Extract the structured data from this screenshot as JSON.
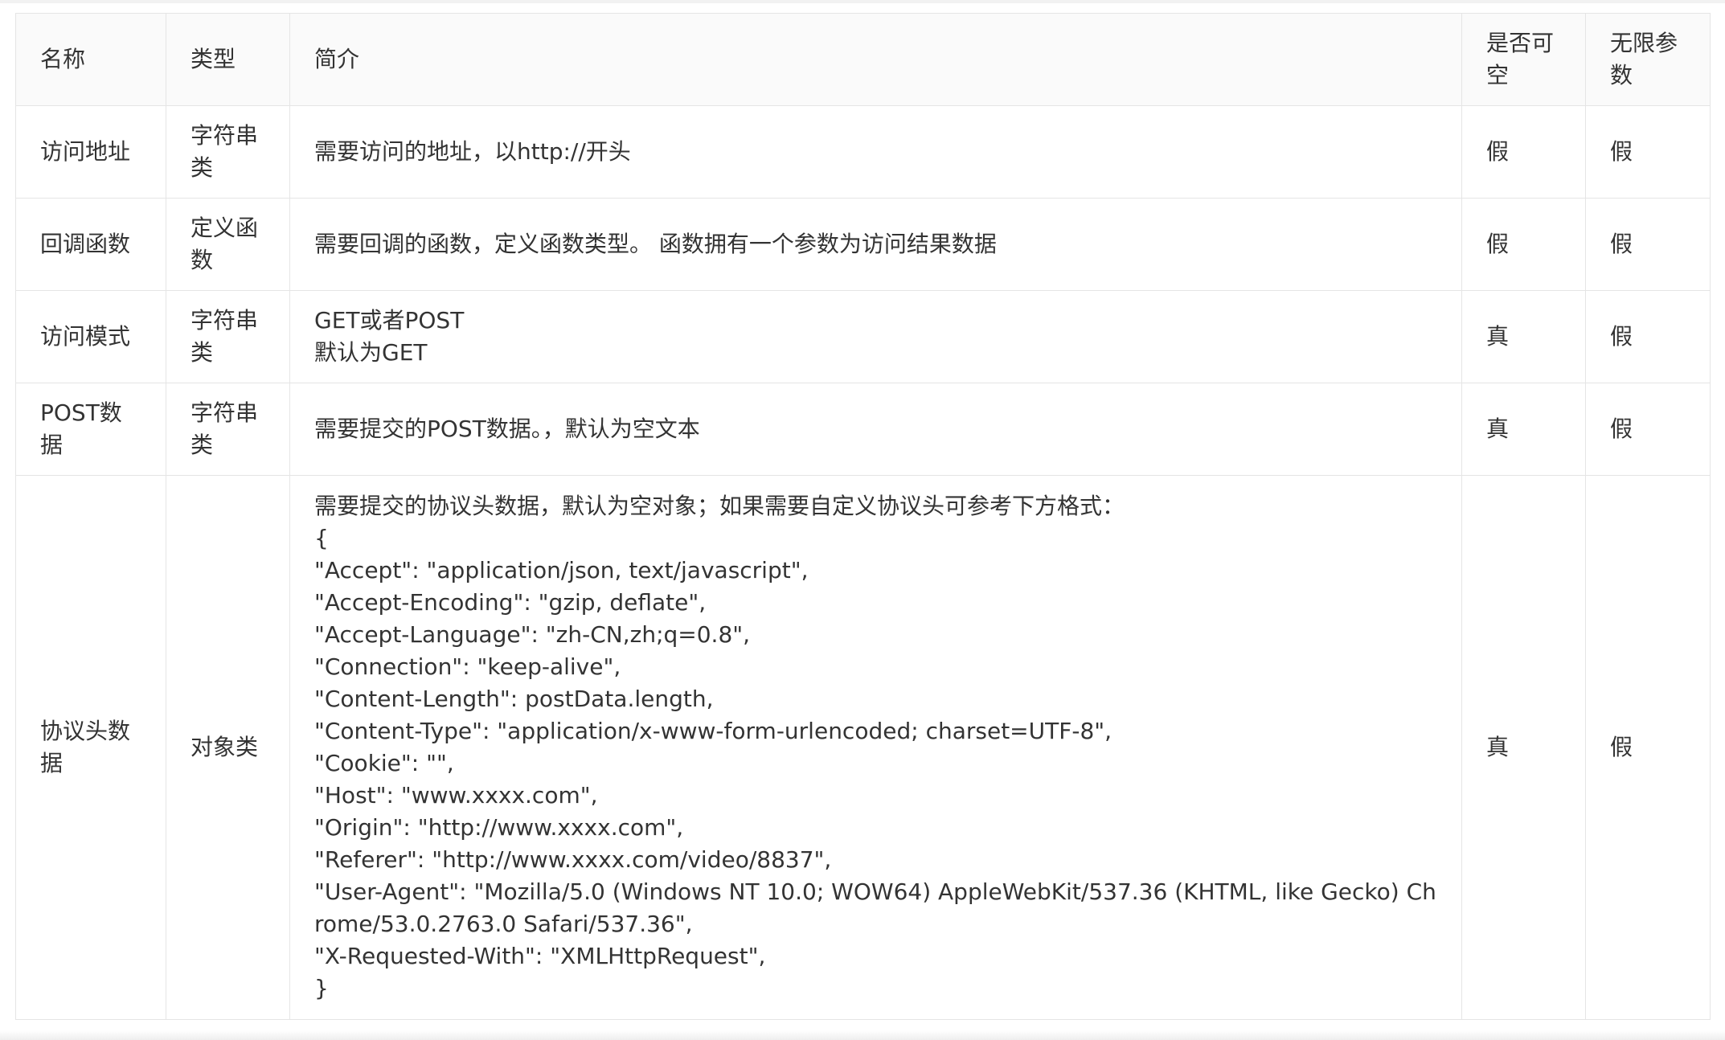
{
  "table": {
    "headers": [
      "名称",
      "类型",
      "简介",
      "是否可空",
      "无限参数"
    ],
    "rows": [
      {
        "name": "访问地址",
        "type": "字符串类",
        "desc": [
          "需要访问的地址，以http://开头"
        ],
        "nullable": "假",
        "varargs": "假"
      },
      {
        "name": "回调函数",
        "type": "定义函数",
        "desc": [
          "需要回调的函数，定义函数类型。 函数拥有一个参数为访问结果数据"
        ],
        "nullable": "假",
        "varargs": "假"
      },
      {
        "name": "访问模式",
        "type": "字符串类",
        "desc": [
          "GET或者POST",
          "默认为GET"
        ],
        "nullable": "真",
        "varargs": "假"
      },
      {
        "name": "POST数据",
        "type": "字符串类",
        "desc": [
          "需要提交的POST数据。，默认为空文本"
        ],
        "nullable": "真",
        "varargs": "假"
      },
      {
        "name": "协议头数据",
        "type": "对象类",
        "desc": [
          "需要提交的协议头数据，默认为空对象；如果需要自定义协议头可参考下方格式：",
          "{",
          "\"Accept\": \"application/json, text/javascript\",",
          "\"Accept-Encoding\": \"gzip, deflate\",",
          "\"Accept-Language\": \"zh-CN,zh;q=0.8\",",
          "\"Connection\": \"keep-alive\",",
          "\"Content-Length\": postData.length,",
          "\"Content-Type\": \"application/x-www-form-urlencoded; charset=UTF-8\",",
          "\"Cookie\": \"\",",
          "\"Host\": \"www.xxxx.com\",",
          "\"Origin\": \"http://www.xxxx.com\",",
          "\"Referer\": \"http://www.xxxx.com/video/8837\",",
          "\"User-Agent\": \"Mozilla/5.0 (Windows NT 10.0; WOW64) AppleWebKit/537.36 (KHTML, like Gecko) Chrome/53.0.2763.0 Safari/537.36\",",
          "\"X-Requested-With\": \"XMLHttpRequest\",",
          "}"
        ],
        "nullable": "真",
        "varargs": "假"
      }
    ]
  }
}
